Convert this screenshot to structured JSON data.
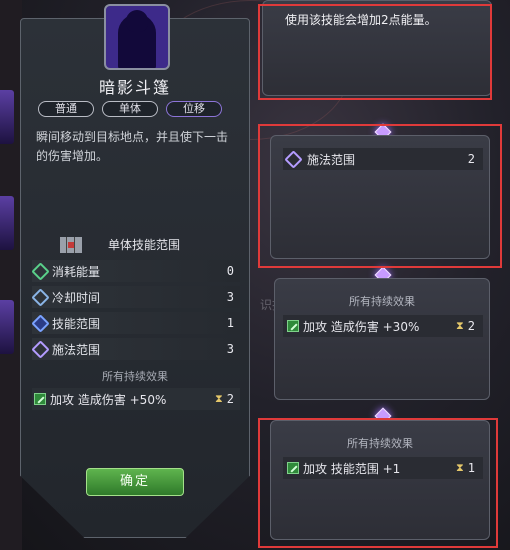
{
  "skill": {
    "name": "暗影斗篷",
    "tags": [
      "普通",
      "单体",
      "位移"
    ],
    "description": "瞬间移动到目标地点，并且使下一击的伤害增加。",
    "range_title": "单体技能范围",
    "stats": [
      {
        "label": "消耗能量",
        "value": "0",
        "icon": "energy-icon"
      },
      {
        "label": "冷却时间",
        "value": "3",
        "icon": "cooldown-icon"
      },
      {
        "label": "技能范围",
        "value": "1",
        "icon": "skill-range-icon"
      },
      {
        "label": "施法范围",
        "value": "3",
        "icon": "cast-range-icon"
      }
    ],
    "effects_heading": "所有持续效果",
    "effect": {
      "text": "加攻  造成伤害 +50%",
      "duration": "2"
    },
    "confirm_label": "确定"
  },
  "cards": {
    "top": {
      "text": "使用该技能会增加2点能量。"
    },
    "cast": {
      "label": "施法范围",
      "value": "2"
    },
    "effect1": {
      "heading": "所有持续效果",
      "text": "加攻  造成伤害 +30%",
      "duration": "2"
    },
    "effect2": {
      "heading": "所有持续效果",
      "text": "加攻  技能范围 +1",
      "duration": "1"
    }
  },
  "background": {
    "partial_text": "识技"
  },
  "colors": {
    "highlight": "#e03a3a",
    "confirm": "#4c9a3c",
    "gem": "#c79bff"
  }
}
